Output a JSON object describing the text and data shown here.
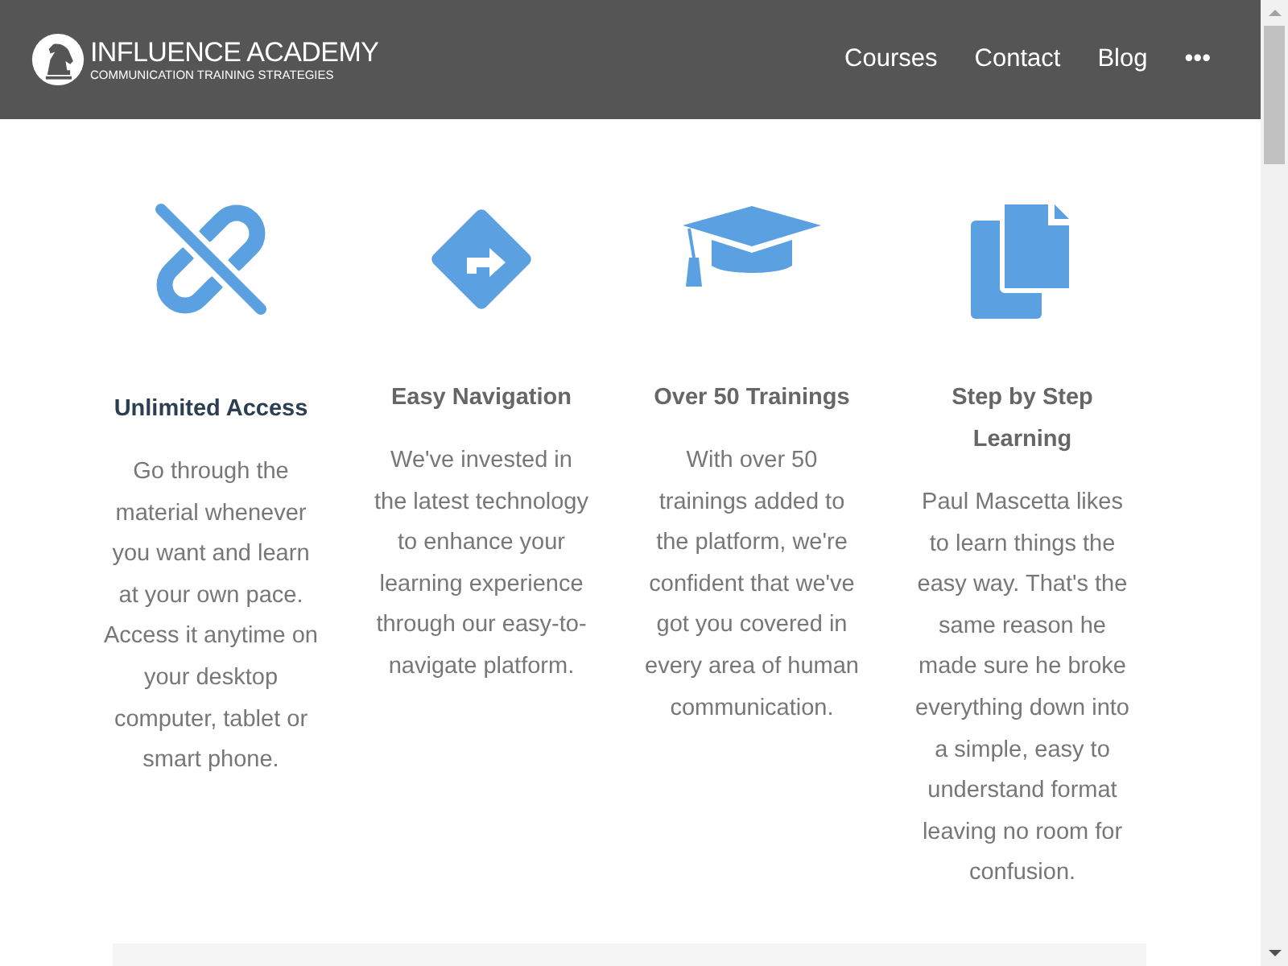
{
  "header": {
    "brand": "INFLUENCE ACADEMY",
    "tagline": "COMMUNICATION TRAINING STRATEGIES",
    "nav": [
      {
        "label": "Courses"
      },
      {
        "label": "Contact"
      },
      {
        "label": "Blog"
      },
      {
        "label": "•••"
      }
    ]
  },
  "features": [
    {
      "title": "Unlimited Access",
      "highlighted": true,
      "text": "Go through the material whenever you want and learn at your own pace. Access it anytime on your desktop computer, tablet or smart phone."
    },
    {
      "title": "Easy Navigation",
      "highlighted": false,
      "text": "We've invested in the latest technology to enhance your learning experience through our easy-to-navigate platform."
    },
    {
      "title": "Over 50 Trainings",
      "highlighted": false,
      "text": "With over 50 trainings added to the platform, we're confident that we've got you covered in every area of human communication."
    },
    {
      "title": "Step by Step Learning",
      "highlighted": false,
      "text": "Paul Mascetta likes to learn things the easy way. That's the same reason he made sure he broke everything down into a simple, easy to understand format leaving no room for confusion."
    }
  ]
}
